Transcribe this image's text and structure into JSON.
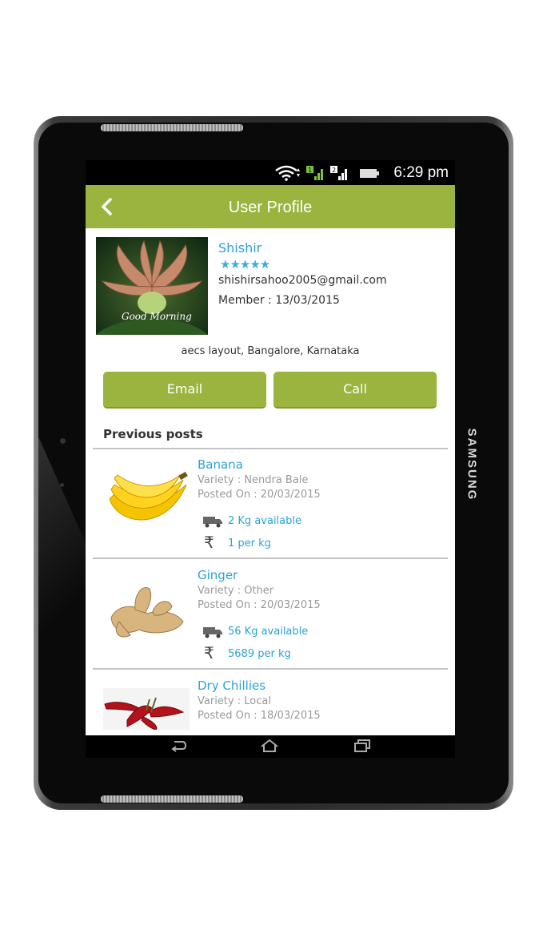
{
  "device": {
    "brand": "SAMSUNG"
  },
  "statusbar": {
    "time": "6:29 pm"
  },
  "appbar": {
    "title": "User Profile",
    "back_icon": "chevron-left-icon"
  },
  "profile": {
    "avatar_caption": "Good Morning",
    "name": "Shishir",
    "rating": 5,
    "stars": "★★★★★",
    "email": "shishirsahoo2005@gmail.com",
    "member": "Member : 13/03/2015",
    "address": "aecs layout, Bangalore, Karnataka"
  },
  "actions": {
    "email_label": "Email",
    "call_label": "Call"
  },
  "posts_heading": "Previous posts",
  "posts": [
    {
      "title": "Banana",
      "variety": "Variety : Nendra Bale",
      "posted": "Posted On : 20/03/2015",
      "qty": "2 Kg available",
      "price": "1 per kg"
    },
    {
      "title": "Ginger",
      "variety": "Variety : Other",
      "posted": "Posted On : 20/03/2015",
      "qty": "56 Kg available",
      "price": "5689 per kg"
    },
    {
      "title": "Dry Chillies",
      "variety": "Variety : Local",
      "posted": "Posted On : 18/03/2015",
      "qty": "",
      "price": ""
    }
  ],
  "rupee_symbol": "₹",
  "colors": {
    "accent": "#9bb43f",
    "link": "#2aa3d8"
  }
}
